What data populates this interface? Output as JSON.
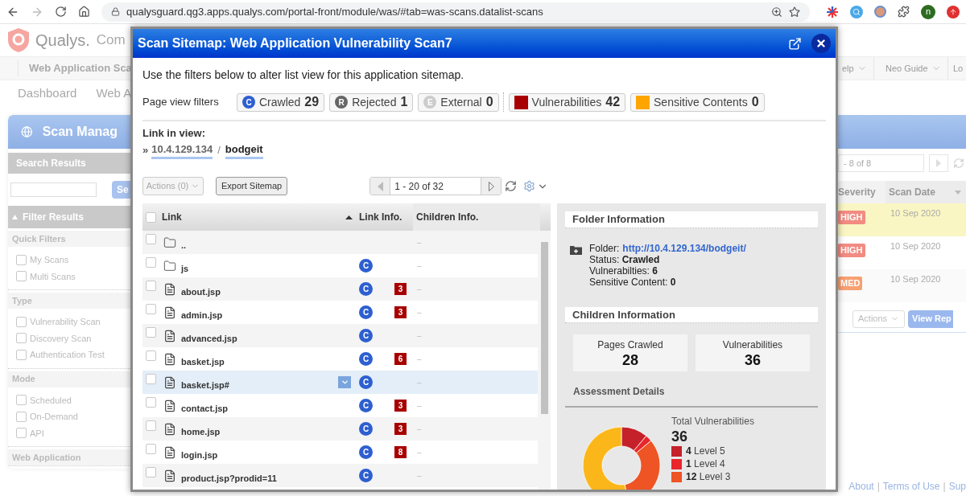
{
  "browser": {
    "url": "qualysguard.qg3.apps.qualys.com/portal-front/module/was/#tab=was-scans.datalist-scans",
    "avatar": "n"
  },
  "app": {
    "logo": "Qualys.",
    "product": "Com",
    "module": "Web Application Sca",
    "right_nav": [
      {
        "label": "elp",
        "dropdown": true
      },
      {
        "label": "Neo Guide",
        "dropdown": true
      },
      {
        "label": "Lo"
      }
    ],
    "tabs": [
      "Dashboard",
      "Web A"
    ]
  },
  "sidebar": {
    "title": "Scan Manag",
    "search_header": "Search Results",
    "search_button": "Se",
    "filter_header": "Filter Results",
    "groups": [
      {
        "title": "Quick Filters",
        "options": [
          {
            "label": "My Scans",
            "checked": false
          },
          {
            "label": "Multi Scans",
            "checked": false
          }
        ]
      },
      {
        "title": "Type",
        "options": [
          {
            "label": "Vulnerability Scan",
            "checked": false
          },
          {
            "label": "Discovery Scan",
            "checked": false
          },
          {
            "label": "Authentication Test",
            "checked": false
          }
        ]
      },
      {
        "title": "Mode",
        "options": [
          {
            "label": "Scheduled",
            "checked": false
          },
          {
            "label": "On-Demand",
            "checked": false
          },
          {
            "label": "API",
            "checked": false
          }
        ]
      },
      {
        "title": "Web Application"
      }
    ]
  },
  "scan_list": {
    "pager": "- 8 of 8",
    "columns": [
      "Severity",
      "Scan Date"
    ],
    "rows": [
      {
        "severity": "HIGH",
        "color": "#f28b82",
        "date": "10 Sep 2020",
        "highlighted": true
      },
      {
        "severity": "HIGH",
        "color": "#f28b82",
        "date": "10 Sep 2020",
        "highlighted": false
      },
      {
        "severity": "MED",
        "color": "#f7a072",
        "date": "10 Sep 2020",
        "highlighted": false
      }
    ],
    "actions_button": "Actions",
    "view_button": "View Rep"
  },
  "footer_links": [
    "About",
    "Terms of Use",
    "Sup"
  ],
  "footer_separator": "|",
  "dialog": {
    "title": "Scan Sitemap: Web Application Vulnerability Scan7",
    "intro": "Use the filters below to alter list view for this application sitemap.",
    "filters_label": "Page view filters",
    "filters": [
      {
        "kind": "status",
        "letter": "C",
        "label": "Crawled",
        "count": "29",
        "color": "#2d5fd0"
      },
      {
        "kind": "status",
        "letter": "R",
        "label": "Rejected",
        "count": "1",
        "color": "#666666"
      },
      {
        "kind": "status",
        "letter": "E",
        "label": "External",
        "count": "0",
        "color": "#cccccc"
      },
      {
        "kind": "swatch",
        "label": "Vulnerabilities",
        "count": "42",
        "color": "#a80000"
      },
      {
        "kind": "swatch",
        "label": "Sensitive Contents",
        "count": "0",
        "color": "#ffa500"
      }
    ],
    "link_in_view_label": "Link in view:",
    "breadcrumb_marker": "»",
    "breadcrumb": [
      "10.4.129.134",
      "bodgeit"
    ],
    "breadcrumb_separator": "/",
    "actions_button": {
      "label": "Actions (0)",
      "disabled": true
    },
    "export_button": "Export Sitemap",
    "pager": "1 - 20 of 32",
    "select_all_checked": false,
    "columns": [
      {
        "label": "Link",
        "sorted": true
      },
      {
        "label": "Link Info.",
        "sorted": false
      },
      {
        "label": "Children Info.",
        "sorted": false
      }
    ],
    "rows": [
      {
        "name": "..",
        "kind": "folder",
        "children": "–",
        "selected": false
      },
      {
        "name": "js",
        "kind": "folder",
        "status": "C",
        "children": "–",
        "selected": false
      },
      {
        "name": "about.jsp",
        "kind": "file",
        "status": "C",
        "vulns": "3",
        "children": "–",
        "selected": false
      },
      {
        "name": "admin.jsp",
        "kind": "file",
        "status": "C",
        "vulns": "3",
        "children": "–",
        "selected": false
      },
      {
        "name": "advanced.jsp",
        "kind": "file",
        "status": "C",
        "children": "–",
        "selected": false
      },
      {
        "name": "basket.jsp",
        "kind": "file",
        "status": "C",
        "vulns": "6",
        "children": "–",
        "selected": false
      },
      {
        "name": "basket.jsp#",
        "kind": "file",
        "status": "C",
        "children": "–",
        "selected": true
      },
      {
        "name": "contact.jsp",
        "kind": "file",
        "status": "C",
        "vulns": "3",
        "children": "–",
        "selected": false
      },
      {
        "name": "home.jsp",
        "kind": "file",
        "status": "C",
        "vulns": "3",
        "children": "–",
        "selected": false
      },
      {
        "name": "login.jsp",
        "kind": "file",
        "status": "C",
        "vulns": "8",
        "children": "–",
        "selected": false
      },
      {
        "name": "product.jsp?prodid=11",
        "kind": "file",
        "status": "C",
        "children": "–",
        "selected": false
      }
    ],
    "folder_info": {
      "title": "Folder Information",
      "label": "Folder:",
      "url": "http://10.4.129.134/bodgeit/",
      "facts": [
        "Status: **Crawled**",
        "Vulnerabilties: **6**",
        "Sensitive Content: **0**"
      ]
    },
    "children_info": {
      "title": "Children Information",
      "stats": [
        {
          "label": "Pages Crawled",
          "value": "28"
        },
        {
          "label": "Vulnerabilities",
          "value": "36"
        }
      ]
    },
    "assessment": {
      "title": "Assessment Details",
      "total_label": "Total Vulnerabilities",
      "total": "36",
      "legend": [
        {
          "count": "4",
          "label": "Level 5",
          "color": "#c4212a"
        },
        {
          "count": "1",
          "label": "Level 4",
          "color": "#e8262c"
        },
        {
          "count": "12",
          "label": "Level 3",
          "color": "#ee5424"
        }
      ]
    }
  }
}
